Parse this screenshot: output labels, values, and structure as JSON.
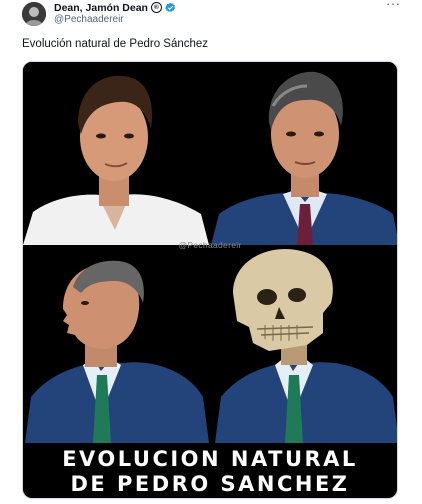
{
  "author": {
    "display_name": "Dean, Jamón Dean",
    "emoji_badge": "®",
    "handle": "@Pechaadereir",
    "verified": true,
    "avatar_icon": "profile-photo-avatar"
  },
  "menu": {
    "more_icon": "ellipsis-horizontal-icon",
    "more_label": "···"
  },
  "tweet": {
    "text": "Evolución natural de Pedro Sánchez"
  },
  "media": {
    "watermark": "@Pechaadereir",
    "caption_line1": "EVOLUCION NATURAL",
    "caption_line2": "DE PEDRO SANCHEZ",
    "panels": [
      "portrait-young-white-shirt",
      "portrait-older-suit-tie",
      "profile-side-view-suit",
      "skull-head-suit"
    ]
  },
  "colors": {
    "text_primary": "#0f1419",
    "text_secondary": "#536471",
    "verified_blue": "#1d9bf0",
    "suit_blue": "#22447a",
    "tie_green": "#1f7a5a",
    "tie_burgundy": "#6b1f3a"
  }
}
